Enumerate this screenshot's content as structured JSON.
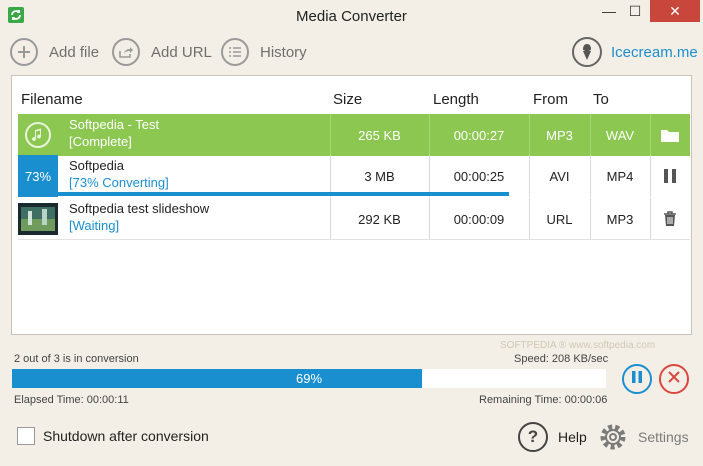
{
  "window": {
    "title": "Media Converter",
    "minimize": "—",
    "maximize": "☐",
    "close": "✕"
  },
  "toolbar": {
    "add_file": "Add file",
    "add_url": "Add URL",
    "history": "History",
    "brand_link": "Icecream.me"
  },
  "columns": {
    "filename": "Filename",
    "size": "Size",
    "length": "Length",
    "from": "From",
    "to": "To"
  },
  "files": [
    {
      "name": "Softpedia - Test",
      "status": "[Complete]",
      "size": "265 KB",
      "length": "00:00:27",
      "from": "MP3",
      "to": "WAV",
      "action_icon": "folder-icon"
    },
    {
      "name": "Softpedia",
      "status": "[73% Converting]",
      "size": "3 MB",
      "length": "00:00:25",
      "from": "AVI",
      "to": "MP4",
      "action_icon": "pause-icon",
      "badge": "73%",
      "progress": 0.73
    },
    {
      "name": "Softpedia test slideshow",
      "status": "[Waiting]",
      "size": "292 KB",
      "length": "00:00:09",
      "from": "URL",
      "to": "MP3",
      "action_icon": "trash-icon"
    }
  ],
  "footer": {
    "conversion_count": "2 out of 3 is in conversion",
    "speed": "Speed: 208 KB/sec",
    "overall_progress": 0.69,
    "overall_label": "69%",
    "elapsed": "Elapsed Time: 00:00:11",
    "remaining": "Remaining Time: 00:00:06",
    "shutdown_label": "Shutdown after conversion",
    "help_label": "Help",
    "settings_label": "Settings"
  },
  "watermark": "SOFTPEDIA ® www.softpedia.com",
  "colors": {
    "accent": "#1a8fd0",
    "complete_row": "#8cc751",
    "cancel": "#d9483f",
    "background": "#f4efe6"
  }
}
